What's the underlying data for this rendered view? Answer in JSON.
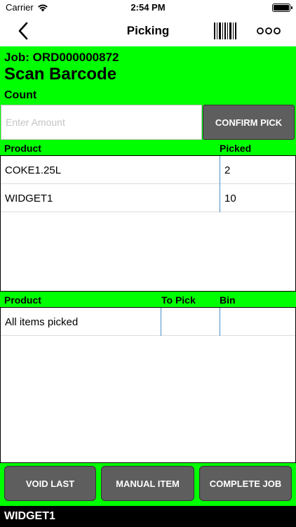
{
  "status_bar": {
    "carrier": "Carrier",
    "time": "2:54 PM"
  },
  "nav": {
    "title": "Picking"
  },
  "job": {
    "label": "Job: ORD000000872",
    "heading": "Scan Barcode",
    "count_label": "Count"
  },
  "amount_input": {
    "placeholder": "Enter Amount",
    "value": ""
  },
  "confirm_button": "CONFIRM PICK",
  "picked_table": {
    "headers": {
      "product": "Product",
      "picked": "Picked"
    },
    "rows": [
      {
        "product": "COKE1.25L",
        "picked": "2"
      },
      {
        "product": "WIDGET1",
        "picked": "10"
      }
    ]
  },
  "to_pick_table": {
    "headers": {
      "product": "Product",
      "to_pick": "To Pick",
      "bin": "Bin"
    },
    "rows": [
      {
        "product": "All items picked",
        "to_pick": "",
        "bin": ""
      }
    ]
  },
  "buttons": {
    "void_last": "VOID LAST",
    "manual_item": "MANUAL ITEM",
    "complete_job": "COMPLETE JOB"
  },
  "footer": {
    "last_item": "WIDGET1"
  },
  "colors": {
    "background": "#00ff00",
    "button": "#5e5e5e",
    "footer": "#000000"
  }
}
